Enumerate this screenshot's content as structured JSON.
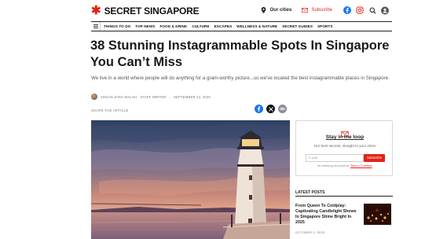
{
  "header": {
    "logo_text": "SECRET SINGAPORE",
    "our_cities": "Our cities",
    "subscribe": "Subscribe",
    "icons": [
      "facebook-icon",
      "instagram-icon",
      "search-icon",
      "user-icon"
    ],
    "brand_color": "#e2231a"
  },
  "nav": {
    "items": [
      "THINGS TO DO",
      "TOP NEWS",
      "FOOD & DRINK",
      "CULTURE",
      "ESCAPES",
      "WELLNESS & NATURE",
      "SECRET GUIDES",
      "SPORTS"
    ]
  },
  "article": {
    "title": "38 Stunning Instagrammable Spots In Singapore You Can’t Miss",
    "subtitle": "We live in a world where people will do anything for a gram-worthy picture...so we've located the best instagrammable places in Singapore.",
    "author": "ARGAN ZARA WALSH · STAFF WRITER",
    "date": "SEPTEMBER 22, 2025",
    "share_label": "SHARE THE ARTICLE",
    "share_icons": [
      "facebook-icon",
      "x-icon",
      "link-icon"
    ]
  },
  "sidebar": {
    "newsletter": {
      "title": "Stay in the loop",
      "subtitle": "Our best secrets, straight to your inbox",
      "email_placeholder": "E-mail",
      "button": "Subscribe",
      "fine_print": "By continuing you accept our",
      "fine_link": "Terms & Conditions"
    },
    "latest_label": "LATEST POSTS",
    "posts": [
      {
        "title": "From Queen To Coldplay: Captivating Candlelight Shows In Singapore Shine Bright In 2025",
        "date": "OCTOBER 2, 2025"
      }
    ]
  }
}
